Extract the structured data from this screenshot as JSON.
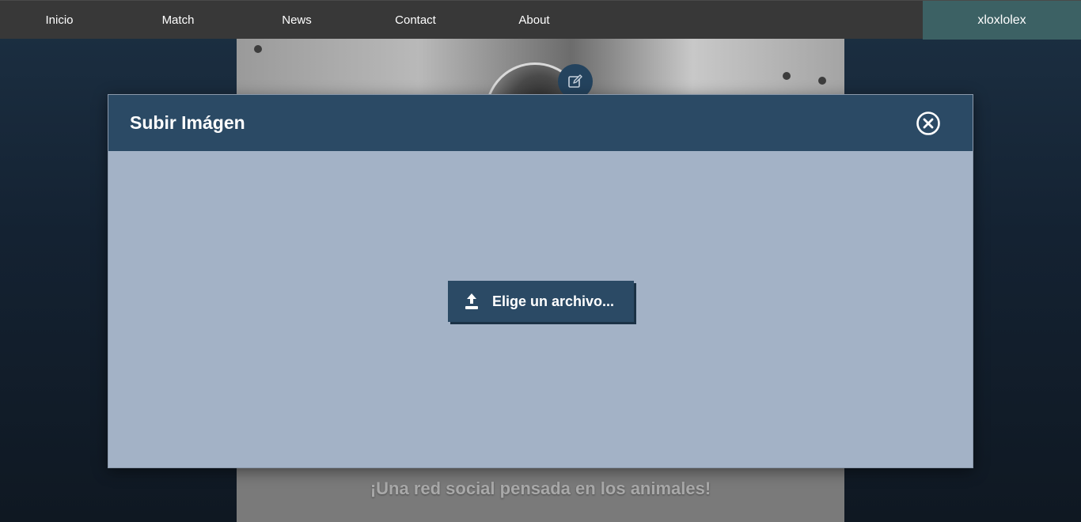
{
  "nav": {
    "items": [
      {
        "label": "Inicio"
      },
      {
        "label": "Match"
      },
      {
        "label": "News"
      },
      {
        "label": "Contact"
      },
      {
        "label": "About"
      }
    ],
    "user": "xloxlolex"
  },
  "profile": {
    "tagline": "¡Una red social pensada en los animales!"
  },
  "modal": {
    "title": "Subir Imágen",
    "file_button_label": "Elige un archivo..."
  },
  "colors": {
    "nav_bg": "#383838",
    "user_tab_bg": "#3c6164",
    "modal_header_bg": "#2b4a65",
    "modal_body_bg": "#a3b2c6"
  },
  "icons": {
    "close": "close-circle-icon",
    "upload": "upload-icon",
    "edit": "edit-icon"
  }
}
